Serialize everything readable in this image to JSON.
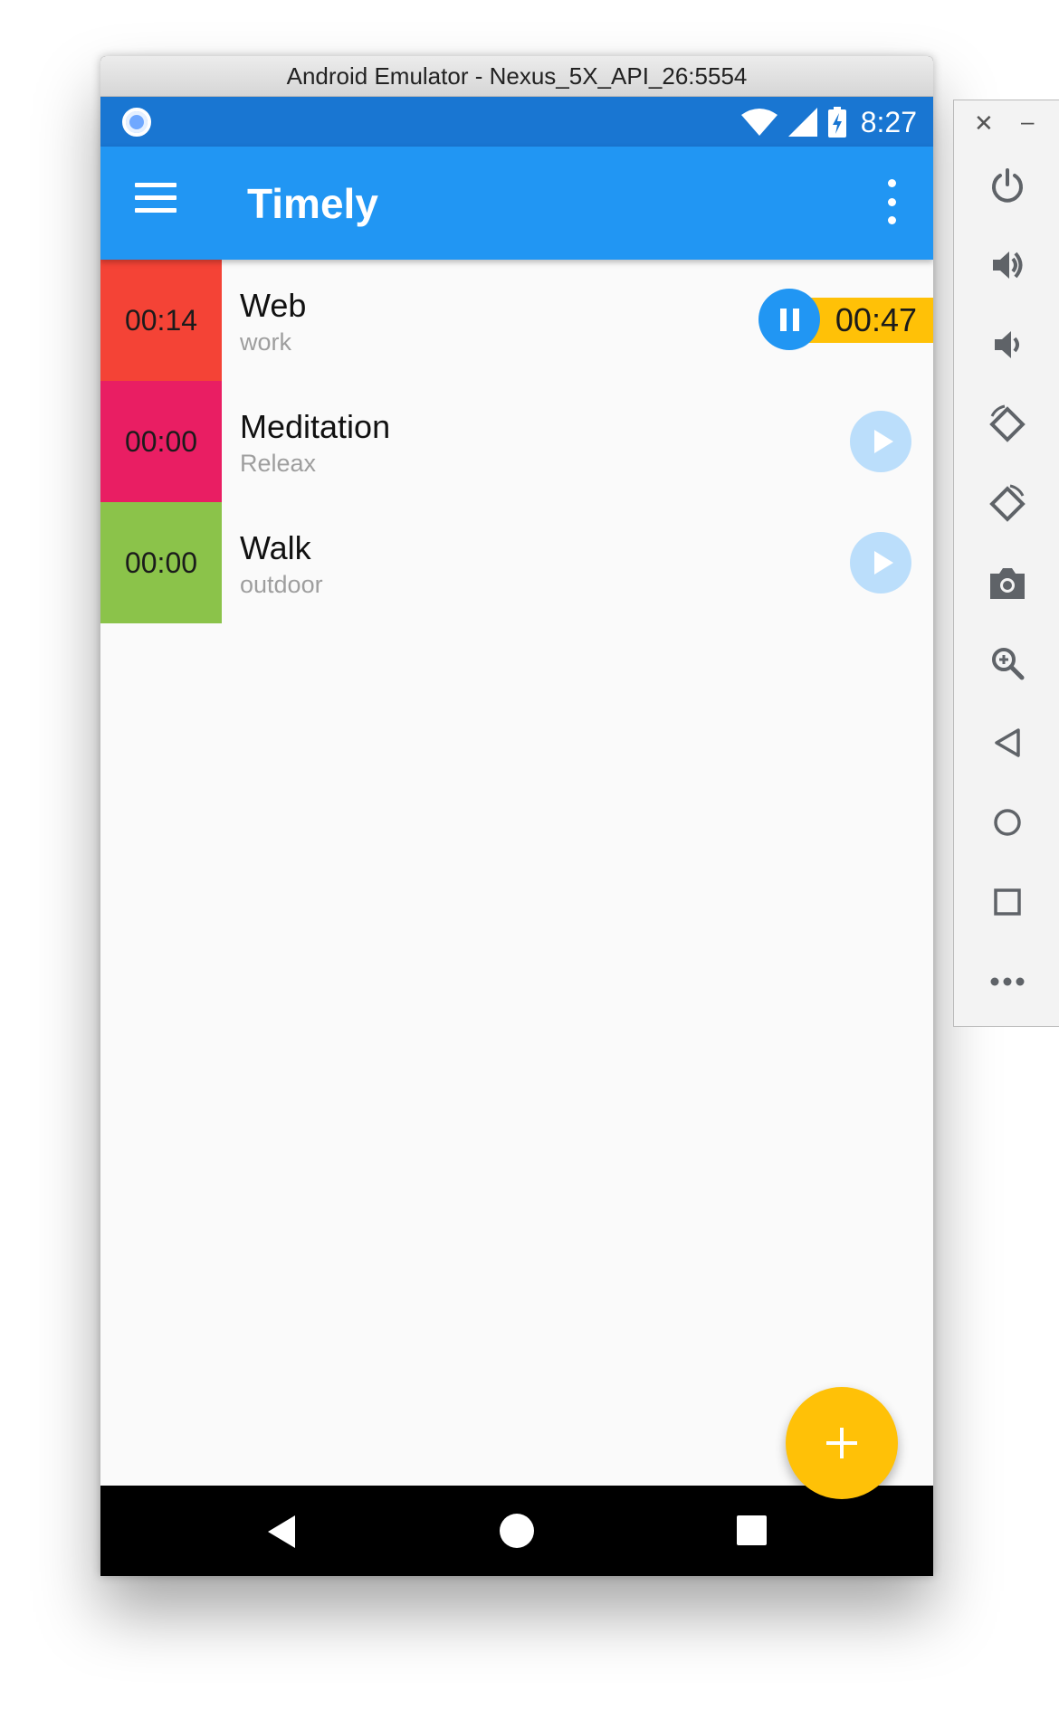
{
  "window": {
    "title": "Android Emulator - Nexus_5X_API_26:5554"
  },
  "status_bar": {
    "time": "8:27"
  },
  "app_bar": {
    "title": "Timely"
  },
  "tasks": [
    {
      "time": "00:14",
      "name": "Web",
      "category": "work",
      "color": "#f44336",
      "running": true,
      "elapsed": "00:47"
    },
    {
      "time": "00:00",
      "name": "Meditation",
      "category": "Releax",
      "color": "#e91e63",
      "running": false
    },
    {
      "time": "00:00",
      "name": "Walk",
      "category": "outdoor",
      "color": "#8bc34a",
      "running": false
    }
  ],
  "colors": {
    "primary": "#2196f3",
    "primary_dark": "#1976d2",
    "accent": "#ffc107"
  },
  "icons": {
    "menu": "hamburger-menu-icon",
    "overflow": "more-vertical-icon",
    "fab": "plus-icon",
    "nav": [
      "back-icon",
      "home-icon",
      "recents-icon"
    ],
    "panel": [
      "power-icon",
      "volume-up-icon",
      "volume-down-icon",
      "rotate-left-icon",
      "rotate-right-icon",
      "camera-icon",
      "zoom-icon",
      "back-icon",
      "home-icon",
      "overview-icon",
      "more-icon"
    ]
  }
}
